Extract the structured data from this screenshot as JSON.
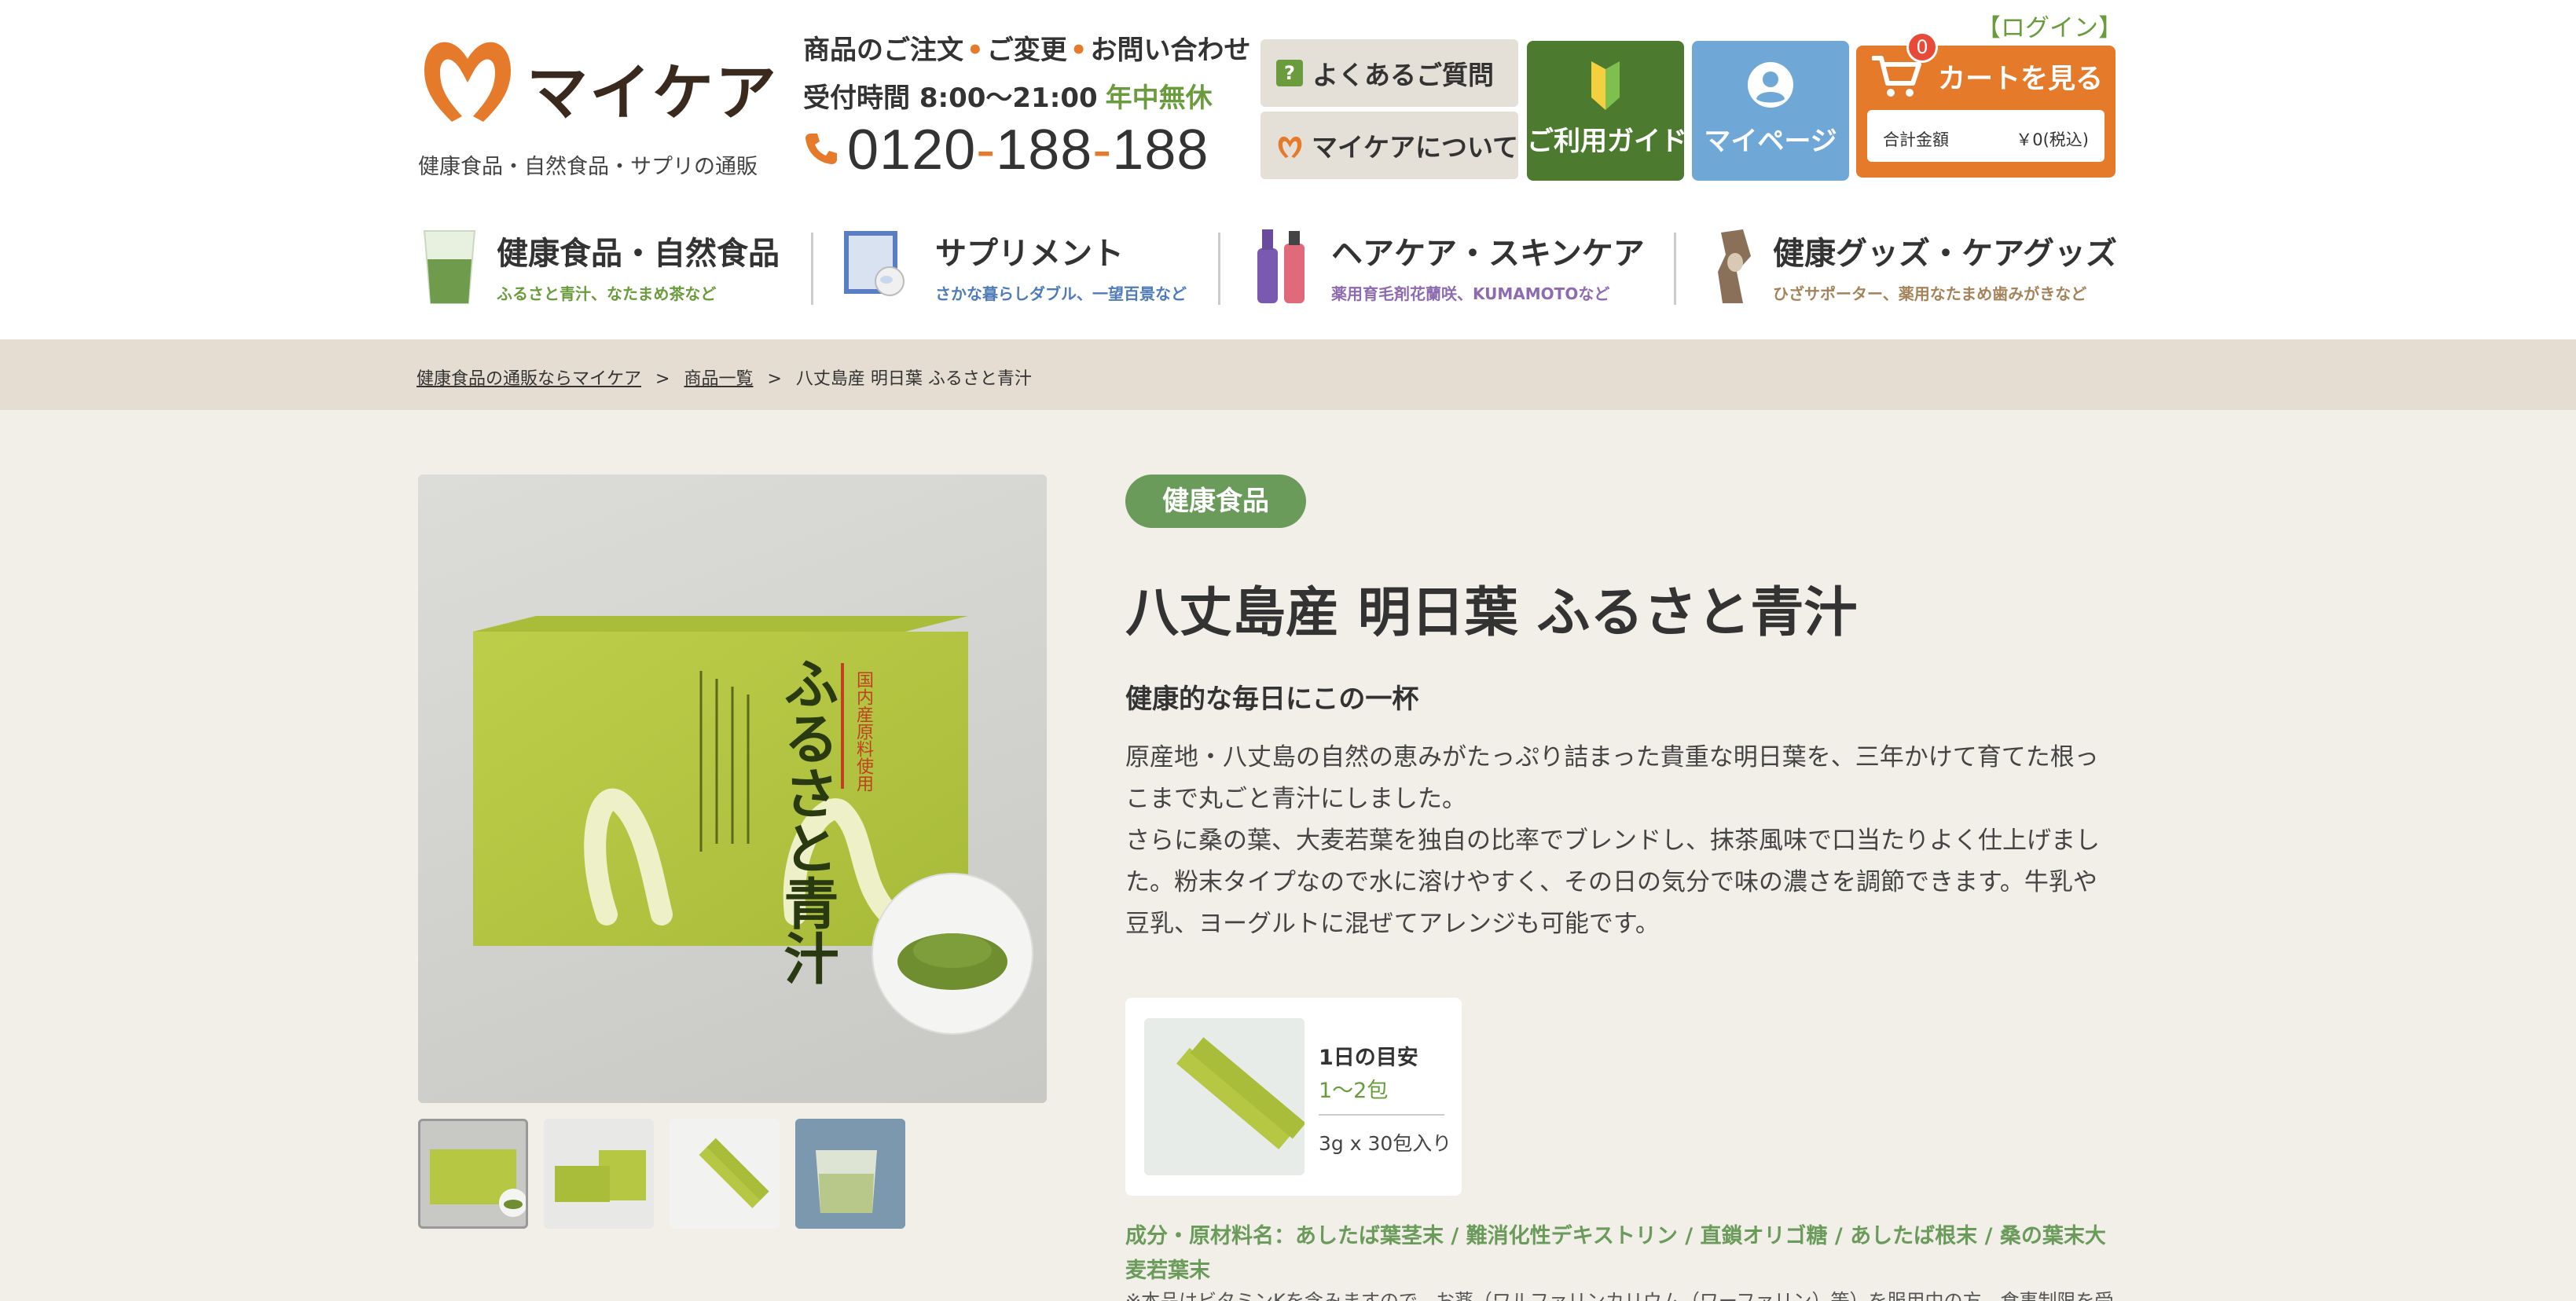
{
  "header": {
    "logo_text": "マイケア",
    "tagline": "健康食品・自然食品・サプリの通販",
    "contact": {
      "order": "商品のご注文",
      "change": "ご変更",
      "inquiry": "お問い合わせ",
      "hours": "受付時間 8:00〜21:00",
      "open": "年中無休",
      "phone_a": "0120",
      "phone_b": "188",
      "phone_c": "188"
    },
    "faq_label": "よくあるご質問",
    "about_label": "マイケアについて",
    "guide_label": "ご利用ガイド",
    "mypage_label": "マイページ",
    "login_label": "【ログイン】",
    "cart": {
      "label": "カートを見る",
      "count": "0",
      "total_key": "合計金額",
      "total_value": "￥0(税込)"
    }
  },
  "categories": [
    {
      "title": "健康食品・自然食品",
      "sub": "ふるさと青汁、なたまめ茶など",
      "sub_color": "#6a9b3c"
    },
    {
      "title": "サプリメント",
      "sub": "さかな暮らしダブル、一望百景など",
      "sub_color": "#4f7cb8"
    },
    {
      "title": "ヘアケア・スキンケア",
      "sub": "薬用育毛剤花蘭咲、KUMAMOTOなど",
      "sub_color": "#8e6bb0"
    },
    {
      "title": "健康グッズ・ケアグッズ",
      "sub": "ひざサポーター、薬用なたまめ歯みがきなど",
      "sub_color": "#a5835a"
    }
  ],
  "breadcrumb": {
    "home": "健康食品の通販ならマイケア",
    "list": "商品一覧",
    "current": "八丈島産 明日葉 ふるさと青汁",
    "sep": ">"
  },
  "product": {
    "category": "健康食品",
    "title": "八丈島産 明日葉 ふるさと青汁",
    "catchphrase": "健康的な毎日にこの一杯",
    "description_1": "原産地・八丈島の自然の恵みがたっぷり詰まった貴重な明日葉を、三年かけて育てた根っこまで丸ごと青汁にしました。",
    "description_2": "さらに桑の葉、大麦若葉を独自の比率でブレンドし、抹茶風味で口当たりよく仕上げました。粉末タイプなので水に溶けやすく、その日の気分で味の濃さを調節できます。牛乳や豆乳、ヨーグルトに混ぜてアレンジも可能です。",
    "box_label": "ふるさと青汁",
    "box_sub": "国内産原料使用",
    "dosage_key": "1日の目安",
    "dosage_value": "1〜2包",
    "pack": "3g x 30包入り",
    "ingredients": "成分・原材料名：あしたば葉茎末 / 難消化性デキストリン / 直鎖オリゴ糖 / あしたば根末 / 桑の葉末大麦若葉末",
    "note": "※本品はビタミンKを含みますので、お薬（ワルファリンカリウム（ワーファリン）等）を服用中の方、食事制限を受けている"
  },
  "colors": {
    "accent_orange": "#e67a2b",
    "brand_green": "#4c7a2e",
    "light_green": "#6a9b3c",
    "mypage_blue": "#6fa8d6",
    "breadcrumb_bg": "#e5ddd2",
    "page_bg": "#f2efe8"
  },
  "icons": [
    "logo-m-icon",
    "phone-icon",
    "question-icon",
    "beginner-leaf-icon",
    "person-icon",
    "cart-icon"
  ]
}
